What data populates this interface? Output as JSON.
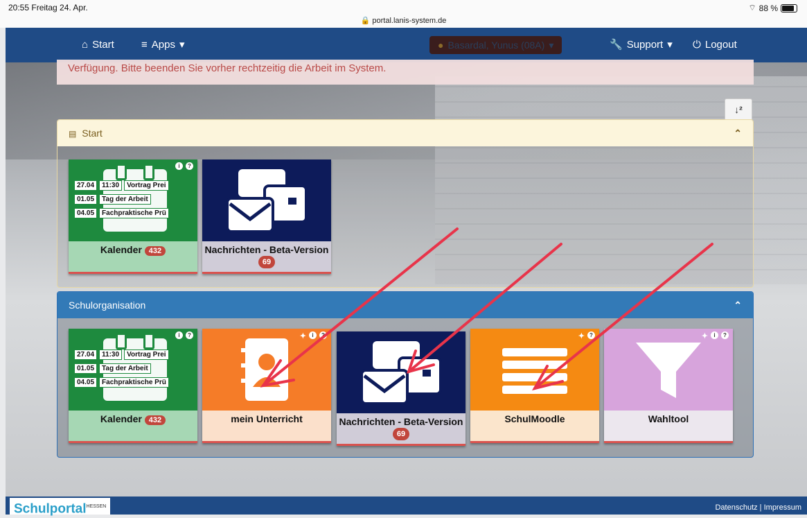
{
  "status_bar": {
    "time_date": "20:55  Freitag 24. Apr.",
    "url": "portal.lanis-system.de",
    "battery": "88 %"
  },
  "nav": {
    "start": "Start",
    "apps": "Apps",
    "user": "Basardal, Yunus (08A)",
    "support": "Support",
    "logout": "Logout"
  },
  "alert": {
    "text": "Verfügung. Bitte beenden Sie vorher rechtzeitig die Arbeit im System."
  },
  "panels": {
    "start": {
      "title": "Start",
      "tiles": {
        "kalender": {
          "label": "Kalender",
          "badge": "432",
          "events": [
            {
              "date": "27.04",
              "time": "11:30",
              "title": "Vortrag Prei"
            },
            {
              "date": "01.05",
              "title": "Tag der Arbeit"
            },
            {
              "date": "04.05",
              "title": "Fachpraktische Prü"
            }
          ]
        },
        "nachrichten": {
          "label": "Nachrichten - Beta-Version",
          "badge": "69"
        }
      }
    },
    "school": {
      "title": "Schulorganisation",
      "tiles": {
        "kalender": {
          "label": "Kalender",
          "badge": "432",
          "events": [
            {
              "date": "27.04",
              "time": "11:30",
              "title": "Vortrag Prei"
            },
            {
              "date": "01.05",
              "title": "Tag der Arbeit"
            },
            {
              "date": "04.05",
              "title": "Fachpraktische Prü"
            }
          ]
        },
        "unterricht": {
          "label": "mein Unterricht"
        },
        "nachrichten": {
          "label": "Nachrichten - Beta-Version",
          "badge": "69"
        },
        "moodle": {
          "label": "SchulMoodle"
        },
        "wahltool": {
          "label": "Wahltool"
        }
      }
    }
  },
  "footer": {
    "logo": "Schulportal",
    "logo_sup": "HESSEN",
    "links": "Datenschutz | Impressum"
  },
  "colors": {
    "navbar": "#1f4b86",
    "panel_school_header": "#337ab7",
    "annotation_arrows": "#e8344a"
  }
}
